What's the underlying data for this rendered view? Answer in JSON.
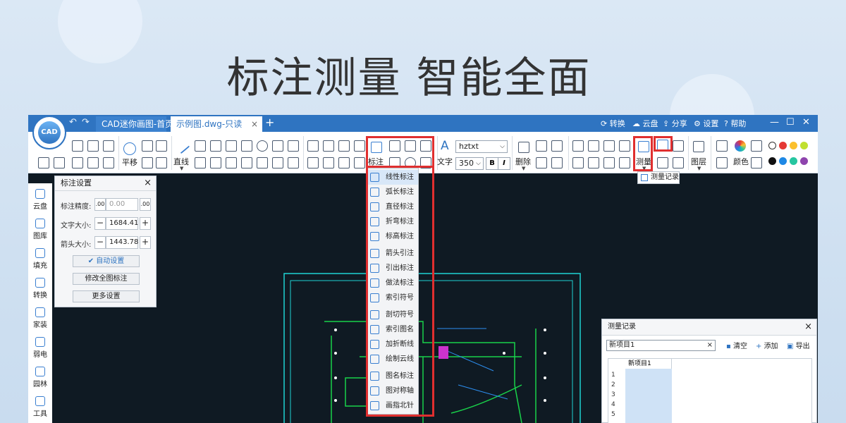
{
  "headline": "标注测量 智能全面",
  "logo_text": "CAD",
  "colors": {
    "accent": "#2f74c1",
    "highlight": "#e02f2f",
    "canvas": "#0f1a23"
  },
  "titlebar": {
    "tabs": [
      {
        "label": "CAD迷你画图-首页"
      },
      {
        "label": "示例图.dwg-只读",
        "close": "×"
      }
    ],
    "new_tab": "+",
    "buttons": [
      "转换",
      "云盘",
      "分享",
      "设置",
      "帮助"
    ],
    "window": [
      "—",
      "☐",
      "✕"
    ]
  },
  "ribbon": {
    "pan": "平移",
    "line": "直线",
    "annotate": "标注",
    "text": "文字",
    "font_value": "hztxt",
    "size_value": "350",
    "bold": "B",
    "italic": "I",
    "delete": "删除",
    "measure": "测量",
    "layer": "图层",
    "color": "颜色",
    "palette": [
      "#ffffff",
      "#e53935",
      "#fbc02d",
      "#c0e030",
      "#111111",
      "#1e88e5",
      "#26c6a0",
      "#8e44ad"
    ]
  },
  "leftbar": [
    "云盘",
    "图库",
    "填充",
    "转换",
    "家装",
    "弱电",
    "园林",
    "工具"
  ],
  "settings_panel": {
    "title": "标注设置",
    "close": "×",
    "precision_label": "标注精度:",
    "precision_value": "0.00",
    "text_size_label": "文字大小:",
    "text_size_value": "1684.41",
    "arrow_size_label": "箭头大小:",
    "arrow_size_value": "1443.78",
    "auto_btn": "✔ 自动设置",
    "modify_all_btn": "修改全图标注",
    "more_btn": "更多设置",
    "minus": "−",
    "plus": "+",
    "prec_dec": ".00",
    "prec_inc": ".00"
  },
  "annotate_menu": [
    "线性标注",
    "弧长标注",
    "直径标注",
    "折弯标注",
    "标高标注",
    "箭头引注",
    "引出标注",
    "做法标注",
    "索引符号",
    "剖切符号",
    "索引图名",
    "加折断线",
    "绘制云线",
    "图名标注",
    "图对称轴",
    "画指北针"
  ],
  "measure_tooltip": "测量记录",
  "measure_panel": {
    "title": "测量记录",
    "close": "×",
    "input_value": "新项目1",
    "clear_x": "×",
    "clear": "清空",
    "add": "添加",
    "export": "导出",
    "column": "新项目1",
    "rows": [
      "1",
      "2",
      "3",
      "4",
      "5"
    ]
  }
}
